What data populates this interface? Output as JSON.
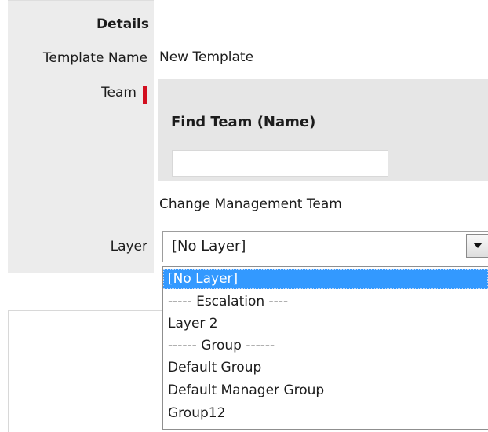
{
  "details": {
    "section_title": "Details",
    "template_name_label": "Template Name",
    "template_name_value": "New Template",
    "team_label": "Team",
    "find_team_title": "Find Team (Name)",
    "find_team_value": "",
    "team_value": "Change Management Team",
    "layer_label": "Layer"
  },
  "layer_select": {
    "selected": "[No Layer]",
    "options": [
      "[No Layer]",
      "----- Escalation ----",
      "Layer 2",
      "------ Group ------",
      "Default Group",
      "Default Manager Group",
      "Group12"
    ],
    "highlighted_index": 0
  },
  "colors": {
    "required_marker": "#d20f1f",
    "highlight": "#3399ff",
    "label_bg": "#ececec"
  }
}
